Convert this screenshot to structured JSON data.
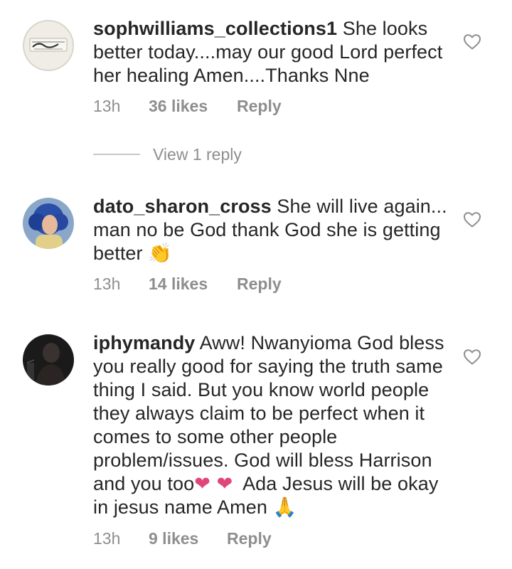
{
  "comments": [
    {
      "username": "sophwilliams_collections1",
      "text": "She looks better today....may our good Lord perfect her healing Amen....Thanks Nne",
      "time": "13h",
      "likes": "36 likes",
      "reply": "Reply"
    },
    {
      "username": "dato_sharon_cross",
      "text": "She will live again... man no be God thank God she is getting better",
      "emoji": "👏",
      "time": "13h",
      "likes": "14 likes",
      "reply": "Reply"
    },
    {
      "username": "iphymandy",
      "text": "Aww! Nwanyioma God bless you really good for saying the truth same thing I said. But you know world people they always claim to be perfect when it comes to some other people problem/issues. God will bless Harrison and you too",
      "emoji_hearts": "❤ ❤",
      "text_after": "Ada Jesus will be okay in jesus name Amen",
      "emoji_end": "🙏",
      "time": "13h",
      "likes": "9 likes",
      "reply": "Reply"
    }
  ],
  "view_replies": "View 1 reply",
  "icons": {
    "like": "heart-outline-icon"
  },
  "colors": {
    "text": "#262626",
    "secondary": "#8e8e8e",
    "heart_emoji": "#e0457b"
  }
}
